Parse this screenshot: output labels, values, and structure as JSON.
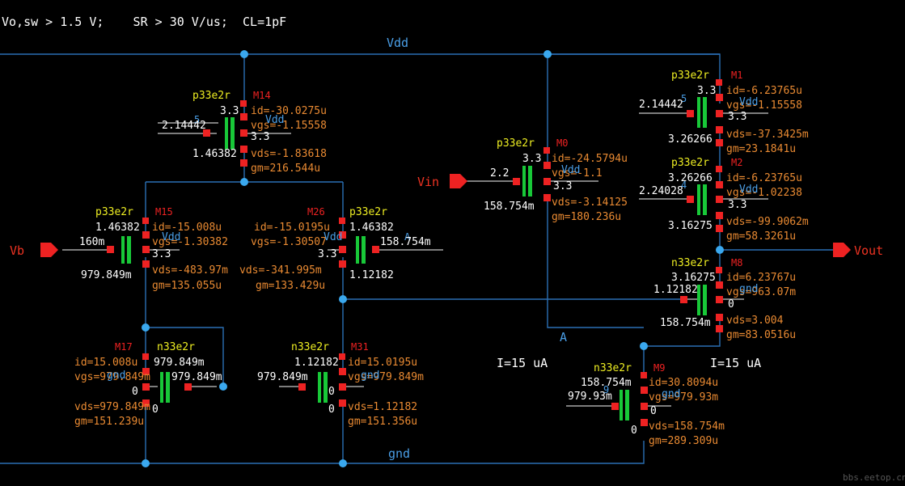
{
  "header": "Vo,sw > 1.5 V;    SR > 30 V/us;  CL=1pF",
  "nets": {
    "vdd_top": "Vdd",
    "gnd_bottom": "gnd",
    "node_a": "A"
  },
  "pins": {
    "vb": "Vb",
    "vin": "Vin",
    "vout": "Vout"
  },
  "currents": {
    "left": "I=15 uA",
    "right": "I=15 uA"
  },
  "watermark": "bbs.eetop.cn",
  "transistors": {
    "m14": {
      "model": "p33e2r",
      "id_label": "M14",
      "wl": "3.3",
      "id": "id=-30.0275u",
      "vgs": "vgs=-1.15558",
      "vds": "vds=-1.83618",
      "gm": "gm=216.544u",
      "g": "2.14442",
      "d": "1.46382",
      "b": "3.3",
      "pin5": "5",
      "body": "Vdd"
    },
    "m15": {
      "model": "p33e2r",
      "id_label": "M15",
      "s": "1.46382",
      "id": "id=-15.008u",
      "vgs": "vgs=-1.30382",
      "vds": "vds=-483.97m",
      "gm": "gm=135.055u",
      "g": "160m",
      "d": "979.849m",
      "b": "3.3",
      "body": "Vdd"
    },
    "m26": {
      "model": "p33e2r",
      "id_label": "M26",
      "s": "1.46382",
      "id": "id=-15.0195u",
      "vgs": "vgs=-1.30507",
      "vds": "vds=-341.995m",
      "gm": "gm=133.429u",
      "g": "158.754m",
      "d": "1.12182",
      "b": "3.3",
      "pinA": "A",
      "body": "Vdd"
    },
    "m17": {
      "model": "n33e2r",
      "id_label": "M17",
      "d": "979.849m",
      "id": "id=15.008u",
      "vgs": "vgs=979.849m",
      "vds": "vds=979.849m",
      "gm": "gm=151.239u",
      "g": "979.849m",
      "s": "0",
      "b": "0",
      "body": "gnd"
    },
    "m31": {
      "model": "n33e2r",
      "id_label": "M31",
      "d": "1.12182",
      "id": "id=15.0195u",
      "vgs": "vgs=979.849m",
      "vds": "vds=1.12182",
      "gm": "gm=151.356u",
      "g": "979.849m",
      "s": "0",
      "b": "0",
      "body": "gnd"
    },
    "m0": {
      "model": "p33e2r",
      "id_label": "M0",
      "wl": "3.3",
      "id": "id=-24.5794u",
      "vgs": "vgs=-1.1",
      "vds": "vds=-3.14125",
      "gm": "gm=180.236u",
      "g": "2.2",
      "d": "158.754m",
      "b": "3.3",
      "body": "Vdd"
    },
    "m1": {
      "model": "p33e2r",
      "id_label": "M1",
      "wl": "3.3",
      "id": "id=-6.23765u",
      "vgs": "vgs=-1.15558",
      "vds": "vds=-37.3425m",
      "gm": "gm=23.1841u",
      "g": "2.14442",
      "d": "3.26266",
      "b": "3.3",
      "pin5": "5",
      "body": "Vdd"
    },
    "m2": {
      "model": "p33e2r",
      "id_label": "M2",
      "s": "3.26266",
      "id": "id=-6.23765u",
      "vgs": "vgs=-1.02238",
      "vds": "vds=-99.9062m",
      "gm": "gm=58.3261u",
      "g": "2.24028",
      "d": "3.16275",
      "b": "3.3",
      "pin4": "4",
      "body": "Vdd"
    },
    "m8": {
      "model": "n33e2r",
      "id_label": "M8",
      "d": "3.16275",
      "id": "id=6.23767u",
      "vgs": "vgs=963.07m",
      "vds": "vds=3.004",
      "gm": "gm=83.0516u",
      "g": "1.12182",
      "s": "158.754m",
      "b": "0",
      "body": "gnd"
    },
    "m9": {
      "model": "n33e2r",
      "id_label": "M9",
      "d": "158.754m",
      "id": "id=30.8094u",
      "vgs": "vgs=979.93m",
      "vds": "vds=158.754m",
      "gm": "gm=289.309u",
      "g": "979.93m",
      "s": "0",
      "b": "0",
      "pin9": "9",
      "body": "gnd"
    }
  }
}
